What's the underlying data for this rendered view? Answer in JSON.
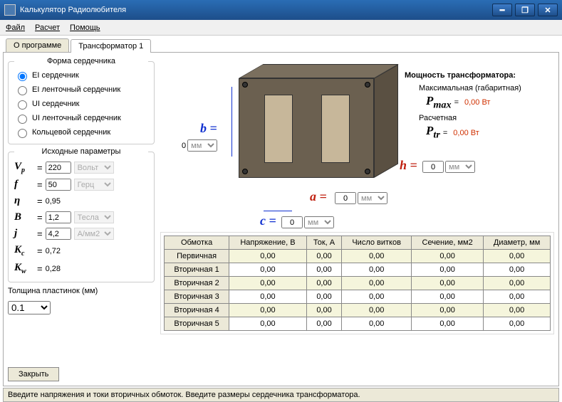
{
  "window": {
    "title": "Калькулятор Радиолюбителя",
    "minimize": "━",
    "maximize": "❐",
    "close": "✕"
  },
  "menu": {
    "file": "Файл",
    "calc": "Расчет",
    "help": "Помощь"
  },
  "tabs": {
    "about": "О программе",
    "trans1": "Трансформатор 1"
  },
  "core_shape": {
    "legend": "Форма сердечника",
    "opt1": "EI сердечник",
    "opt2": "EI ленточный сердечник",
    "opt3": "UI сердечник",
    "opt4": "UI ленточный сердечник",
    "opt5": "Кольцевой сердечник"
  },
  "params": {
    "legend": "Исходные параметры",
    "vp": {
      "sym": "V",
      "sub": "p",
      "val": "220",
      "unit": "Вольт"
    },
    "f": {
      "sym": "f",
      "val": "50",
      "unit": "Герц"
    },
    "eta": {
      "sym": "η",
      "val": "0,95"
    },
    "B": {
      "sym": "B",
      "val": "1,2",
      "unit": "Тесла"
    },
    "j": {
      "sym": "j",
      "val": "4,2",
      "unit": "А/мм2"
    },
    "Kc": {
      "sym": "K",
      "sub": "c",
      "val": "0,72"
    },
    "Kw": {
      "sym": "K",
      "sub": "w",
      "val": "0,28"
    }
  },
  "plate": {
    "label": "Толщина пластинок (мм)",
    "val": "0.1"
  },
  "close_btn": "Закрыть",
  "dims": {
    "b": {
      "label": "b =",
      "val": "0",
      "unit": "мм"
    },
    "a": {
      "label": "a =",
      "val": "0",
      "unit": "мм"
    },
    "c": {
      "label": "c =",
      "val": "0",
      "unit": "мм"
    },
    "h": {
      "label": "h =",
      "val": "0",
      "unit": "мм"
    }
  },
  "power": {
    "header": "Мощность трансформатора:",
    "max_label": "Максимальная (габаритная)",
    "max_sym": "P",
    "max_sub": "max",
    "max_eq": "=",
    "max_val": "0,00 Вт",
    "calc_label": "Расчетная",
    "tr_sym": "P",
    "tr_sub": "tr",
    "tr_eq": "=",
    "tr_val": "0,00 Вт"
  },
  "table": {
    "headers": {
      "winding": "Обмотка",
      "voltage": "Напряжение, В",
      "current": "Ток, А",
      "turns": "Число витков",
      "section": "Сечение, мм2",
      "diameter": "Диаметр, мм"
    },
    "rows": [
      {
        "name": "Первичная",
        "v": "0,00",
        "i": "0,00",
        "n": "0,00",
        "s": "0,00",
        "d": "0,00"
      },
      {
        "name": "Вторичная 1",
        "v": "0,00",
        "i": "0,00",
        "n": "0,00",
        "s": "0,00",
        "d": "0,00"
      },
      {
        "name": "Вторичная 2",
        "v": "0,00",
        "i": "0,00",
        "n": "0,00",
        "s": "0,00",
        "d": "0,00"
      },
      {
        "name": "Вторичная 3",
        "v": "0,00",
        "i": "0,00",
        "n": "0,00",
        "s": "0,00",
        "d": "0,00"
      },
      {
        "name": "Вторичная 4",
        "v": "0,00",
        "i": "0,00",
        "n": "0,00",
        "s": "0,00",
        "d": "0,00"
      },
      {
        "name": "Вторичная 5",
        "v": "0,00",
        "i": "0,00",
        "n": "0,00",
        "s": "0,00",
        "d": "0,00"
      }
    ]
  },
  "status": "Введите напряжения и токи вторичных обмоток. Введите размеры сердечника трансформатора."
}
